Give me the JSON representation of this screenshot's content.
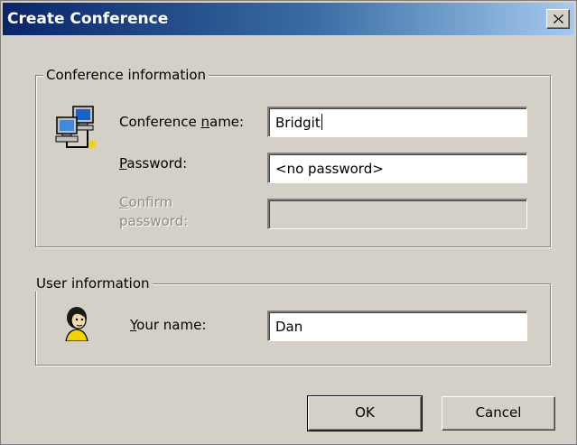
{
  "window": {
    "title": "Create Conference"
  },
  "conference_group": {
    "legend": "Conference information",
    "name_label_pre": "Conference ",
    "name_label_key": "n",
    "name_label_post": "ame:",
    "name_value": "Bridgit",
    "password_label_key": "P",
    "password_label_post": "assword:",
    "password_value": "<no password>",
    "confirm_label_key": "C",
    "confirm_label_line1_post": "onfirm",
    "confirm_label_line2": "password:",
    "confirm_value": ""
  },
  "user_group": {
    "legend": "User information",
    "name_label_key": "Y",
    "name_label_post": "our name:",
    "name_value": "Dan"
  },
  "buttons": {
    "ok": "OK",
    "cancel": "Cancel"
  },
  "icons": {
    "title_close": "close-icon",
    "conference": "network-computers-icon",
    "user": "user-person-icon"
  }
}
